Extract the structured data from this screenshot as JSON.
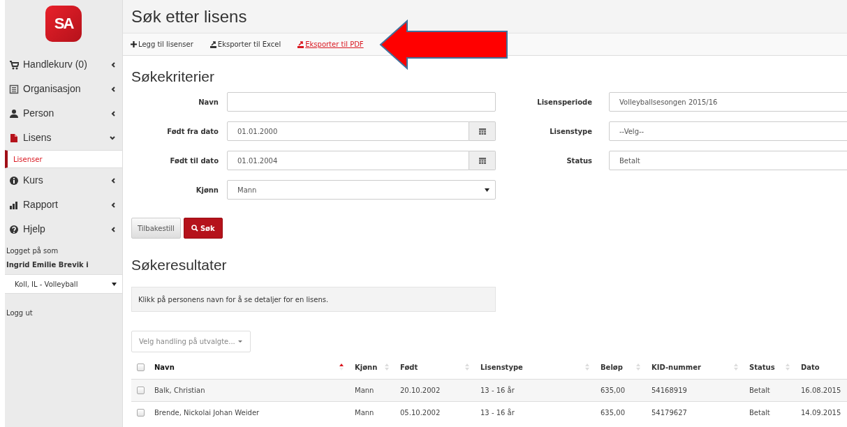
{
  "page_title": "Søk etter lisens",
  "sidebar": {
    "logo": "SA",
    "items": [
      {
        "label": "Handlekurv (0)",
        "expanded": false
      },
      {
        "label": "Organisasjon",
        "expanded": false
      },
      {
        "label": "Person",
        "expanded": false
      },
      {
        "label": "Lisens",
        "expanded": true,
        "children": [
          {
            "label": "Lisenser",
            "selected": true
          }
        ]
      },
      {
        "label": "Kurs",
        "expanded": false
      },
      {
        "label": "Rapport",
        "expanded": false
      },
      {
        "label": "Hjelp",
        "expanded": false
      }
    ],
    "logged_in_label": "Logget på som",
    "user_name": "Ingrid Emilie Brevik i",
    "organization": "Koll, IL - Volleyball",
    "logout": "Logg ut"
  },
  "toolbar": [
    {
      "label": "Legg til lisenser",
      "highlighted": false
    },
    {
      "label": "Eksporter til Excel",
      "highlighted": false
    },
    {
      "label": "Eksporter til PDF",
      "highlighted": true
    }
  ],
  "criteria_title": "Søkekriterier",
  "left_fields": [
    {
      "label": "Navn",
      "kind": "text"
    },
    {
      "label": "Født fra dato",
      "kind": "date",
      "value": "01.01.2000"
    },
    {
      "label": "Født til dato",
      "kind": "date",
      "value": "01.01.2004"
    },
    {
      "label": "Kjønn",
      "kind": "select",
      "value": "Mann"
    }
  ],
  "right_fields": [
    {
      "label": "Lisensperiode",
      "kind": "text",
      "value": "Volleyballsesongen 2015/16"
    },
    {
      "label": "Lisenstype",
      "kind": "text",
      "value": "--Velg--"
    },
    {
      "label": "Status",
      "kind": "text",
      "value": "Betalt"
    }
  ],
  "reset_button": "Tilbakestill",
  "search_button": "Søk",
  "results_title": "Søkeresultater",
  "info": "Klikk på personens navn for å se detaljer for en lisens.",
  "bulk_action": "Velg handling på utvalgte...",
  "table": {
    "header_checked": false,
    "columns": [
      {
        "label": "Navn",
        "sortable": true,
        "sorted": true
      },
      {
        "label": "Kjønn",
        "sortable": true,
        "sorted": false
      },
      {
        "label": "Født",
        "sortable": true,
        "sorted": false
      },
      {
        "label": "Lisenstype",
        "sortable": true,
        "sorted": false
      },
      {
        "label": "Beløp",
        "sortable": true,
        "sorted": false
      },
      {
        "label": "KID-nummer",
        "sortable": true,
        "sorted": false
      },
      {
        "label": "Status",
        "sortable": true,
        "sorted": false
      },
      {
        "label": "Dato",
        "sortable": false,
        "sorted": false
      }
    ],
    "rows": [
      {
        "checked": false,
        "cells": [
          "Balk, Christian",
          "Mann",
          "20.10.2002",
          "13 - 16 år",
          "635,00",
          "54168919",
          "Betalt",
          "16.08.2015"
        ]
      },
      {
        "checked": false,
        "cells": [
          "Brende, Nickolai Johan Weider",
          "Mann",
          "05.10.2002",
          "13 - 16 år",
          "635,00",
          "54179627",
          "Betalt",
          "14.09.2015"
        ]
      }
    ]
  }
}
